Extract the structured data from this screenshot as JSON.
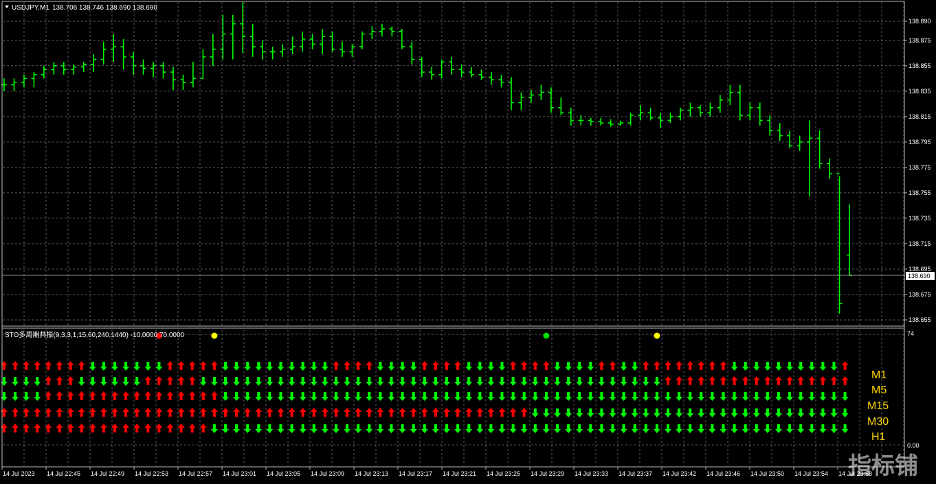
{
  "main": {
    "symbol_label": "USDJPY,M1",
    "ohlc_label": "138.706 138.746 138.690 138.690",
    "price_axis": [
      "138.890",
      "138.875",
      "138.855",
      "138.835",
      "138.815",
      "138.795",
      "138.775",
      "138.755",
      "138.735",
      "138.715",
      "138.695",
      "138.675",
      "138.655"
    ],
    "current_price": "138.690",
    "candle_color": "#00ff00",
    "grid_color": "#5a5a5a"
  },
  "indicator": {
    "title": "STO多周期共振(9,3,3,1,15,60,240,1440) -10.0000 70.0000",
    "axis_top": "74",
    "axis_bottom": "0.00",
    "timeframes": [
      "M1",
      "M5",
      "M15",
      "M30",
      "H1"
    ],
    "up_color": "#ff0000",
    "down_color": "#00ff00",
    "dots": [
      {
        "col": 14,
        "color": "#ff0000"
      },
      {
        "col": 19,
        "color": "#ffff00"
      },
      {
        "col": 49,
        "color": "#00dd00"
      },
      {
        "col": 59,
        "color": "#ffff00"
      }
    ],
    "rows": [
      "UUUUUUUUDDDDDDDUUUUUDDDDDDDDDDUUUUDDDDUUUUDDDDUUUUDDDDUUDDUUUUUUUUDDDDDDDDDDUUUUDD",
      "DDDDUUUDDDDDDUUUUUDDDDDDDDDDDDDDDDDDDDDDDDDDDDDDDDDDDDDDDDDDUUUUUUUUUUUUUUUUUUUUDD",
      "DDDDUUUUUUUUUUUUUUUUDDDDDDDDDDDDDDDDDDDDDDDDDDDDDDDDDDDDDDDDDDDDDDDDDDDDDDDDDDDDDD",
      "UUUUUUUUUUUUUUUUUUUUUUUUUUUUUUUUUUUUUUUUUUUUUUUUDDDDDDDDDDDDDDDDDDDDDDDDDDDDDDDDDD",
      "UUUUUUUUUUUUUUUUUUUDDDDDDDDDDDDDDDDDDDDDDDDDDDDDDDDDDDDDDDDDDDDDDDDDDDDDDDDDDDDDDD"
    ]
  },
  "time_axis": [
    "14 Jul 2023",
    "14 Jul 22:45",
    "14 Jul 22:49",
    "14 Jul 22:53",
    "14 Jul 22:57",
    "14 Jul 23:01",
    "14 Jul 23:05",
    "14 Jul 23:09",
    "14 Jul 23:13",
    "14 Jul 23:17",
    "14 Jul 23:21",
    "14 Jul 23:25",
    "14 Jul 23:29",
    "14 Jul 23:33",
    "14 Jul 23:37",
    "14 Jul 23:42",
    "14 Jul 23:46",
    "14 Jul 23:50",
    "14 Jul 23:54",
    "14 Jul 23:58"
  ],
  "watermark": "指标铺",
  "chart_data": {
    "type": "candlestick",
    "title": "USDJPY,M1",
    "ylim": [
      138.645,
      138.905
    ],
    "candles": [
      [
        138.84,
        138.845,
        138.835,
        138.84
      ],
      [
        138.84,
        138.845,
        138.835,
        138.842
      ],
      [
        138.842,
        138.848,
        138.838,
        138.845
      ],
      [
        138.845,
        138.85,
        138.838,
        138.848
      ],
      [
        138.848,
        138.855,
        138.845,
        138.852
      ],
      [
        138.852,
        138.858,
        138.848,
        138.855
      ],
      [
        138.855,
        138.858,
        138.848,
        138.852
      ],
      [
        138.852,
        138.856,
        138.848,
        138.854
      ],
      [
        138.854,
        138.858,
        138.85,
        138.856
      ],
      [
        138.856,
        138.864,
        138.85,
        138.86
      ],
      [
        138.86,
        138.874,
        138.856,
        138.868
      ],
      [
        138.868,
        138.88,
        138.858,
        138.87
      ],
      [
        138.87,
        138.876,
        138.852,
        138.862
      ],
      [
        138.862,
        138.866,
        138.848,
        138.855
      ],
      [
        138.855,
        138.86,
        138.848,
        138.853
      ],
      [
        138.853,
        138.858,
        138.846,
        138.855
      ],
      [
        138.855,
        138.858,
        138.845,
        138.85
      ],
      [
        138.85,
        138.854,
        138.836,
        138.844
      ],
      [
        138.844,
        138.848,
        138.836,
        138.842
      ],
      [
        138.842,
        138.858,
        138.838,
        138.845
      ],
      [
        138.845,
        138.868,
        138.845,
        138.862
      ],
      [
        138.862,
        138.88,
        138.855,
        138.868
      ],
      [
        138.868,
        138.895,
        138.86,
        138.88
      ],
      [
        138.88,
        138.895,
        138.86,
        138.888
      ],
      [
        138.888,
        138.905,
        138.865,
        138.878
      ],
      [
        138.878,
        138.888,
        138.862,
        138.87
      ],
      [
        138.87,
        138.875,
        138.86,
        138.866
      ],
      [
        138.866,
        138.87,
        138.86,
        138.866
      ],
      [
        138.866,
        138.872,
        138.862,
        138.868
      ],
      [
        138.868,
        138.878,
        138.864,
        138.87
      ],
      [
        138.87,
        138.882,
        138.866,
        138.876
      ],
      [
        138.876,
        138.88,
        138.868,
        138.872
      ],
      [
        138.872,
        138.884,
        138.864,
        138.878
      ],
      [
        138.878,
        138.882,
        138.866,
        138.868
      ],
      [
        138.868,
        138.874,
        138.862,
        138.866
      ],
      [
        138.866,
        138.872,
        138.862,
        138.87
      ],
      [
        138.87,
        138.882,
        138.868,
        138.88
      ],
      [
        138.88,
        138.886,
        138.876,
        138.882
      ],
      [
        138.882,
        138.888,
        138.878,
        138.884
      ],
      [
        138.884,
        138.886,
        138.878,
        138.882
      ],
      [
        138.882,
        138.884,
        138.868,
        138.87
      ],
      [
        138.87,
        138.874,
        138.856,
        138.86
      ],
      [
        138.86,
        138.862,
        138.846,
        138.85
      ],
      [
        138.85,
        138.854,
        138.844,
        138.848
      ],
      [
        138.848,
        138.86,
        138.845,
        138.858
      ],
      [
        138.858,
        138.862,
        138.848,
        138.852
      ],
      [
        138.852,
        138.856,
        138.846,
        138.85
      ],
      [
        138.85,
        138.854,
        138.846,
        138.848
      ],
      [
        138.848,
        138.852,
        138.844,
        138.846
      ],
      [
        138.846,
        138.85,
        138.84,
        138.844
      ],
      [
        138.844,
        138.848,
        138.838,
        138.842
      ],
      [
        138.842,
        138.846,
        138.82,
        138.826
      ],
      [
        138.826,
        138.834,
        138.82,
        138.83
      ],
      [
        138.83,
        138.836,
        138.826,
        138.832
      ],
      [
        138.832,
        138.84,
        138.828,
        138.834
      ],
      [
        138.834,
        138.838,
        138.818,
        138.822
      ],
      [
        138.822,
        138.83,
        138.816,
        138.818
      ],
      [
        138.818,
        138.822,
        138.808,
        138.812
      ],
      [
        138.812,
        138.816,
        138.808,
        138.812
      ],
      [
        138.812,
        138.814,
        138.808,
        138.811
      ],
      [
        138.811,
        138.814,
        138.808,
        138.81
      ],
      [
        138.81,
        138.813,
        138.807,
        138.809
      ],
      [
        138.809,
        138.812,
        138.808,
        138.81
      ],
      [
        138.81,
        138.818,
        138.808,
        138.816
      ],
      [
        138.816,
        138.824,
        138.812,
        138.818
      ],
      [
        138.818,
        138.822,
        138.812,
        138.814
      ],
      [
        138.814,
        138.818,
        138.806,
        138.812
      ],
      [
        138.812,
        138.818,
        138.81,
        138.815
      ],
      [
        138.815,
        138.822,
        138.812,
        138.82
      ],
      [
        138.82,
        138.826,
        138.815,
        138.822
      ],
      [
        138.822,
        138.824,
        138.815,
        138.818
      ],
      [
        138.818,
        138.826,
        138.815,
        138.822
      ],
      [
        138.822,
        138.832,
        138.818,
        138.828
      ],
      [
        138.828,
        138.84,
        138.824,
        138.834
      ],
      [
        138.834,
        138.84,
        138.812,
        138.816
      ],
      [
        138.816,
        138.826,
        138.812,
        138.822
      ],
      [
        138.822,
        138.826,
        138.808,
        138.812
      ],
      [
        138.812,
        138.816,
        138.8,
        138.804
      ],
      [
        138.804,
        138.81,
        138.796,
        138.8
      ],
      [
        138.8,
        138.804,
        138.79,
        138.792
      ],
      [
        138.792,
        138.8,
        138.788,
        138.795
      ],
      [
        138.795,
        138.812,
        138.752,
        138.798
      ],
      [
        138.798,
        138.804,
        138.774,
        138.778
      ],
      [
        138.778,
        138.782,
        138.766,
        138.77
      ],
      [
        138.77,
        138.768,
        138.66,
        138.668
      ],
      [
        138.706,
        138.746,
        138.69,
        138.69
      ]
    ]
  }
}
